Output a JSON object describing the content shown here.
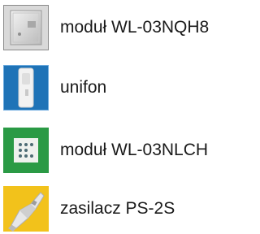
{
  "items": [
    {
      "label": "moduł WL-03NQH8",
      "icon": "module-box-icon",
      "color": "#e6e6e6"
    },
    {
      "label": "unifon",
      "icon": "intercom-handset-icon",
      "color": "#1f73b7"
    },
    {
      "label": "moduł WL-03NLCH",
      "icon": "keypad-module-icon",
      "color": "#2a9a45"
    },
    {
      "label": "zasilacz PS-2S",
      "icon": "power-supply-icon",
      "color": "#f2c21b"
    }
  ]
}
